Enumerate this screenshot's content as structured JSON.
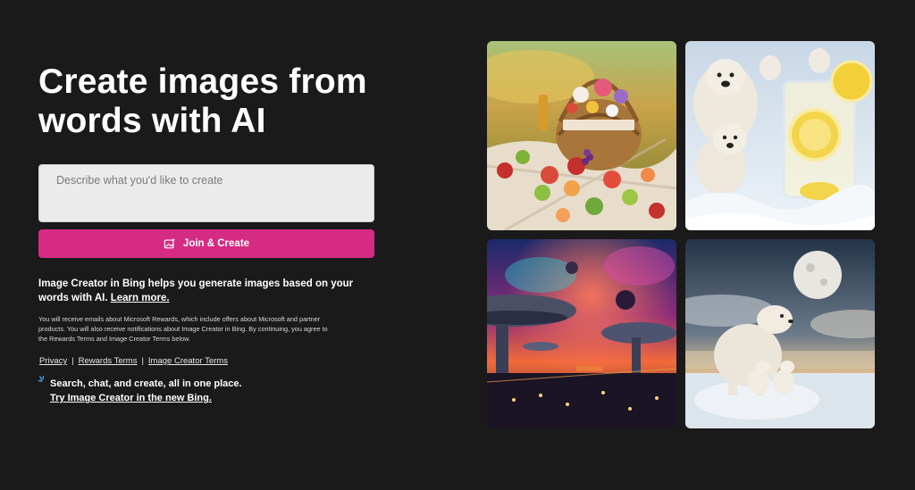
{
  "hero": {
    "title_line1": "Create images from",
    "title_line2": "words with AI"
  },
  "prompt": {
    "placeholder": "Describe what you'd like to create",
    "value": ""
  },
  "join_button": {
    "label": "Join & Create",
    "icon": "image-sparkle-icon",
    "color": "#d52b82"
  },
  "description": {
    "text": "Image Creator in Bing helps you generate images based on your words with AI.",
    "learn_more": "Learn more."
  },
  "fine_print": "You will receive emails about Microsoft Rewards, which include offers about Microsoft and partner products. You will also receive notifications about Image Creator in Bing. By continuing, you agree to the Rewards Terms and Image Creator Terms below.",
  "links": {
    "privacy": "Privacy",
    "separator": "|",
    "rewards_terms": "Rewards Terms",
    "image_creator_terms": "Image Creator Terms"
  },
  "promo": {
    "icon": "sparkle-icon",
    "text": "Search, chat, and create, all in one place.",
    "link": "Try Image Creator in the new Bing."
  },
  "gallery": [
    {
      "name": "picnic-basket-image"
    },
    {
      "name": "polar-bears-lemonade-image"
    },
    {
      "name": "space-city-nebula-image"
    },
    {
      "name": "polar-bears-moon-image"
    }
  ],
  "colors": {
    "background": "#1b1a1a",
    "accent": "#d52b82",
    "input_bg": "#ebebeb"
  }
}
